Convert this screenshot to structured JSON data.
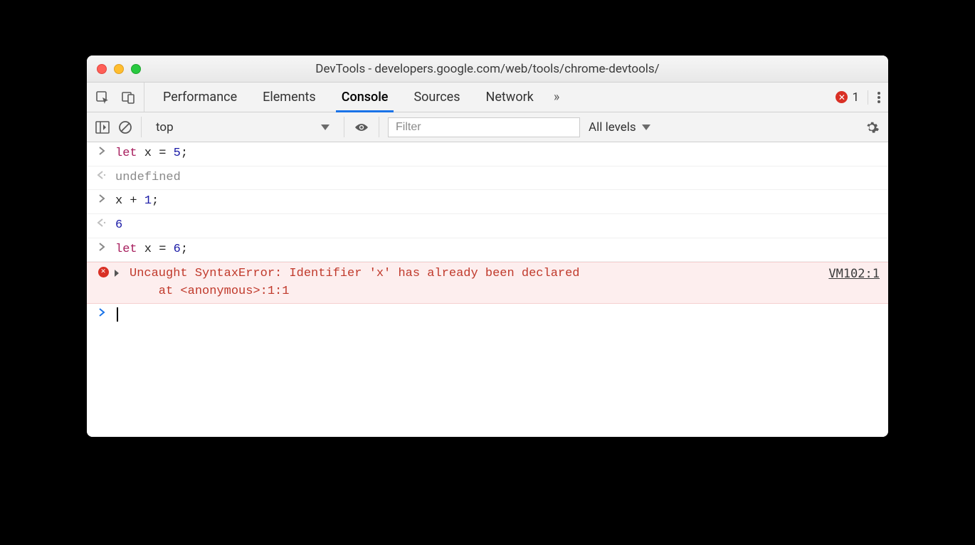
{
  "window": {
    "title": "DevTools - developers.google.com/web/tools/chrome-devtools/"
  },
  "tabs": {
    "items": [
      "Performance",
      "Elements",
      "Console",
      "Sources",
      "Network"
    ],
    "active": "Console",
    "overflow": "»"
  },
  "errorBadge": {
    "count": "1"
  },
  "consoleToolbar": {
    "context": "top",
    "filterPlaceholder": "Filter",
    "levels": "All levels"
  },
  "consoleLines": [
    {
      "kind": "input",
      "tokens": [
        [
          "kw",
          "let"
        ],
        [
          "d",
          " x "
        ],
        [
          "d",
          "="
        ],
        [
          "d",
          " "
        ],
        [
          "num",
          "5"
        ],
        [
          "d",
          ";"
        ]
      ]
    },
    {
      "kind": "output",
      "tokens": [
        [
          "undef",
          "undefined"
        ]
      ]
    },
    {
      "kind": "input",
      "tokens": [
        [
          "d",
          "x "
        ],
        [
          "d",
          "+"
        ],
        [
          "d",
          " "
        ],
        [
          "num",
          "1"
        ],
        [
          "d",
          ";"
        ]
      ]
    },
    {
      "kind": "output",
      "tokens": [
        [
          "num",
          "6"
        ]
      ]
    },
    {
      "kind": "input",
      "tokens": [
        [
          "kw",
          "let"
        ],
        [
          "d",
          " x "
        ],
        [
          "d",
          "="
        ],
        [
          "d",
          " "
        ],
        [
          "num",
          "6"
        ],
        [
          "d",
          ";"
        ]
      ]
    },
    {
      "kind": "error",
      "message": "Uncaught SyntaxError: Identifier 'x' has already been declared\n    at <anonymous>:1:1",
      "source": "VM102:1"
    },
    {
      "kind": "prompt"
    }
  ]
}
